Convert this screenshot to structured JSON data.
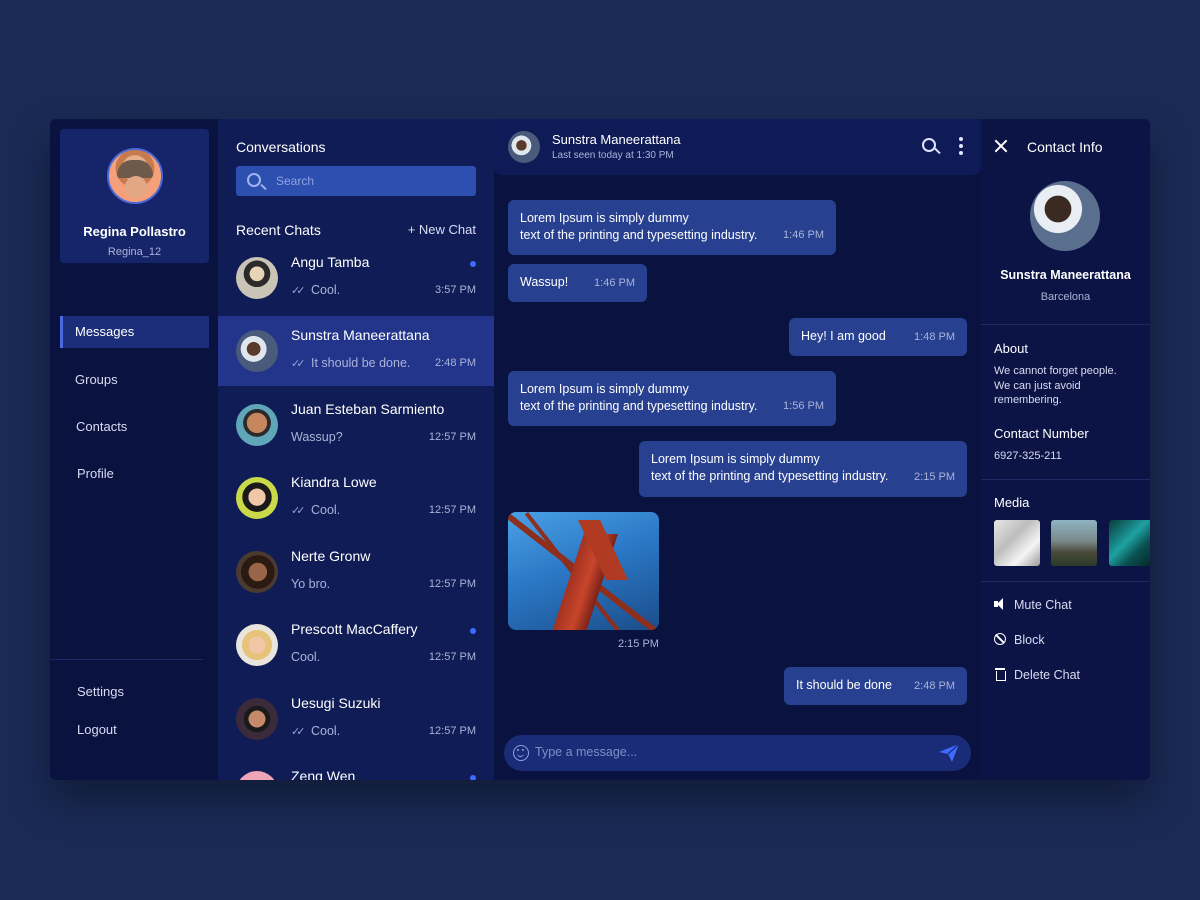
{
  "user": {
    "name": "Regina Pollastro",
    "handle": "Regina_12"
  },
  "nav": {
    "items": [
      {
        "label": "Messages",
        "active": true
      },
      {
        "label": "Groups"
      },
      {
        "label": "Contacts"
      },
      {
        "label": "Profile"
      }
    ],
    "bottom": [
      {
        "label": "Settings"
      },
      {
        "label": "Logout"
      }
    ]
  },
  "conversations": {
    "title": "Conversations",
    "search_placeholder": "Search",
    "recent_title": "Recent Chats",
    "new_chat": "+ New Chat",
    "chats": [
      {
        "name": "Angu Tamba",
        "message": "Cool.",
        "time": "3:57 PM",
        "read_check": true,
        "unread": true
      },
      {
        "name": "Sunstra Maneerattana",
        "message": "It should be done.",
        "time": "2:48 PM",
        "read_check": true,
        "active": true
      },
      {
        "name": "Juan Esteban Sarmiento",
        "message": "Wassup?",
        "time": "12:57 PM"
      },
      {
        "name": "Kiandra Lowe",
        "message": "Cool.",
        "time": "12:57 PM",
        "read_check": true
      },
      {
        "name": "Nerte Gronw",
        "message": "Yo bro.",
        "time": "12:57 PM"
      },
      {
        "name": "Prescott MacCaffery",
        "message": "Cool.",
        "time": "12:57 PM",
        "unread": true
      },
      {
        "name": "Uesugi Suzuki",
        "message": "Cool.",
        "time": "12:57 PM",
        "read_check": true
      },
      {
        "name": "Zeng Wen",
        "message": "",
        "time": "",
        "unread": true
      }
    ]
  },
  "chat": {
    "contact_name": "Sunstra Maneerattana",
    "status": "Last seen today at 1:30 PM",
    "messages": [
      {
        "side": "left",
        "lines": [
          "Lorem Ipsum is simply dummy",
          "text of the printing and typesetting industry."
        ],
        "time": "1:46 PM"
      },
      {
        "side": "left",
        "lines": [
          "Wassup!"
        ],
        "time": "1:46 PM"
      },
      {
        "side": "right",
        "lines": [
          "Hey! I am good"
        ],
        "time": "1:48 PM"
      },
      {
        "side": "left",
        "lines": [
          "Lorem Ipsum is simply dummy",
          "text of the printing and typesetting industry."
        ],
        "time": "1:56 PM"
      },
      {
        "side": "right",
        "lines": [
          "Lorem Ipsum is simply dummy",
          "text of the printing and typesetting industry."
        ],
        "time": "2:15 PM"
      },
      {
        "side": "left",
        "type": "image",
        "time": "2:15 PM"
      },
      {
        "side": "right",
        "lines": [
          "It should be done"
        ],
        "time": "2:48 PM"
      }
    ],
    "composer_placeholder": "Type a message..."
  },
  "contact_info": {
    "title": "Contact Info",
    "name": "Sunstra Maneerattana",
    "city": "Barcelona",
    "about_label": "About",
    "about_text": "We cannot forget people. We can just avoid remembering.",
    "number_label": "Contact Number",
    "number": "6927-325-211",
    "media_label": "Media",
    "actions": [
      {
        "label": "Mute Chat",
        "icon": "speaker-icon"
      },
      {
        "label": "Block",
        "icon": "block-icon"
      },
      {
        "label": "Delete Chat",
        "icon": "trash-icon"
      }
    ]
  },
  "colors": {
    "background": "#1a2a55",
    "panel": "#0c1445",
    "accent": "#3e6bff",
    "bubble": "#27408f",
    "active_row": "#22358a"
  }
}
